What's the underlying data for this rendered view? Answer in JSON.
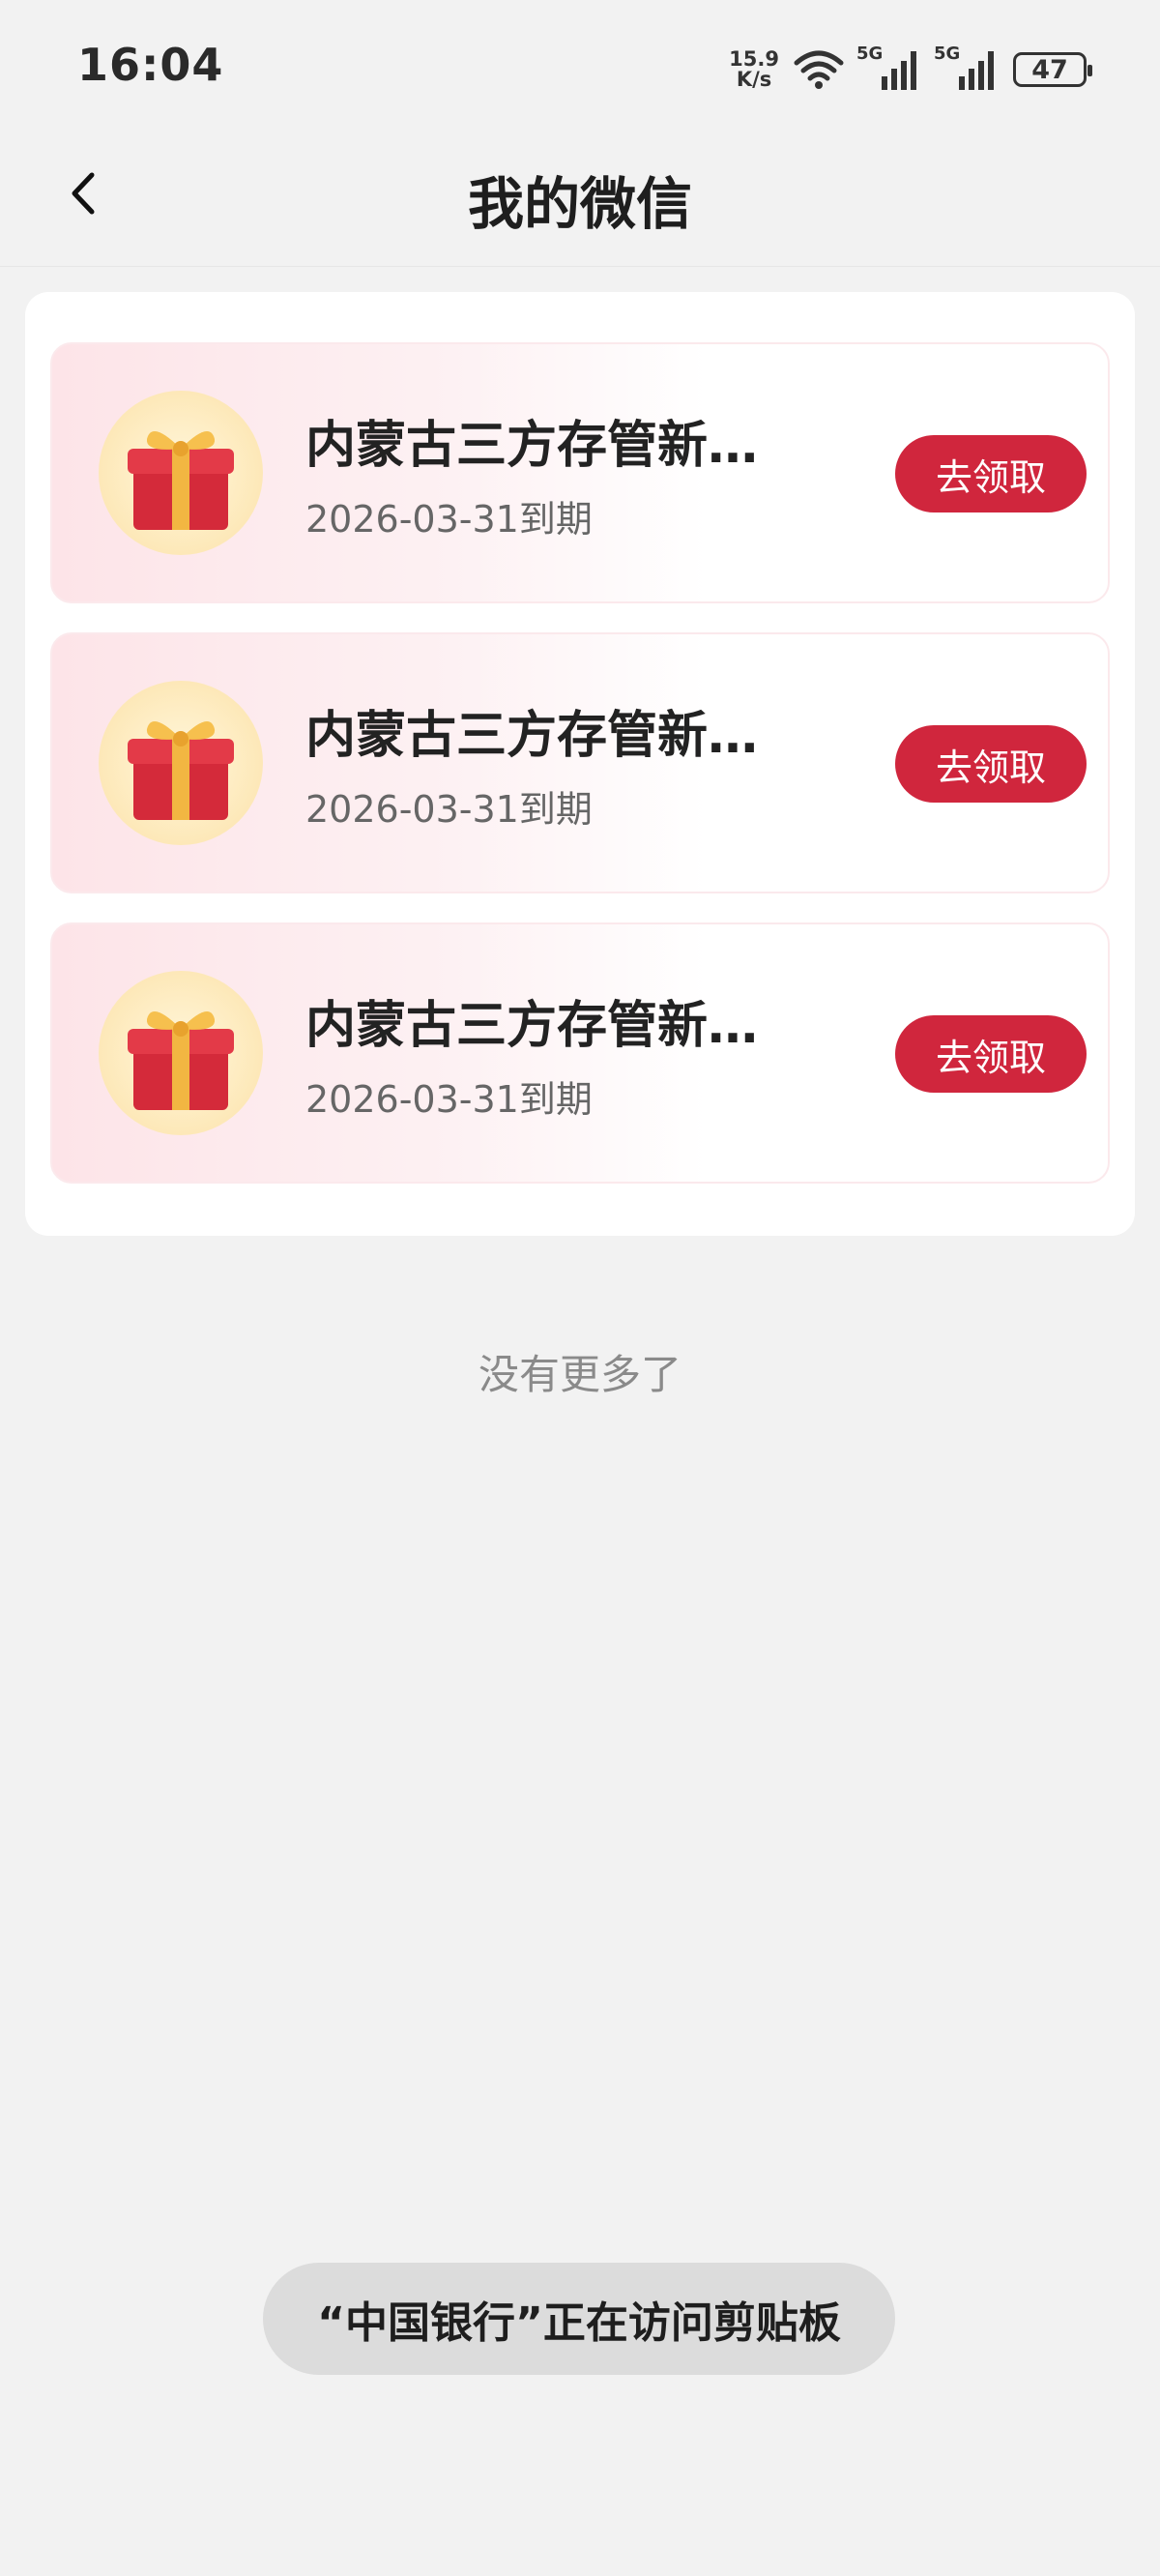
{
  "status_bar": {
    "time": "16:04",
    "net_speed_value": "15.9",
    "net_speed_unit": "K/s",
    "sim1_label": "5G",
    "sim2_label": "5G",
    "battery": "47"
  },
  "header": {
    "title": "我的微信"
  },
  "coupons": [
    {
      "title": "内蒙古三方存管新客...",
      "date": "2026-03-31到期",
      "button": "去领取"
    },
    {
      "title": "内蒙古三方存管新客...",
      "date": "2026-03-31到期",
      "button": "去领取"
    },
    {
      "title": "内蒙古三方存管新客...",
      "date": "2026-03-31到期",
      "button": "去领取"
    }
  ],
  "footer": {
    "no_more": "没有更多了"
  },
  "toast": {
    "text": "“中国银行”正在访问剪贴板"
  },
  "colors": {
    "accent": "#d0263d",
    "background": "#f2f2f2",
    "card": "#ffffff"
  },
  "icons": [
    "back-arrow-icon",
    "wifi-icon",
    "signal-icon",
    "battery-icon",
    "gift-box-icon"
  ]
}
